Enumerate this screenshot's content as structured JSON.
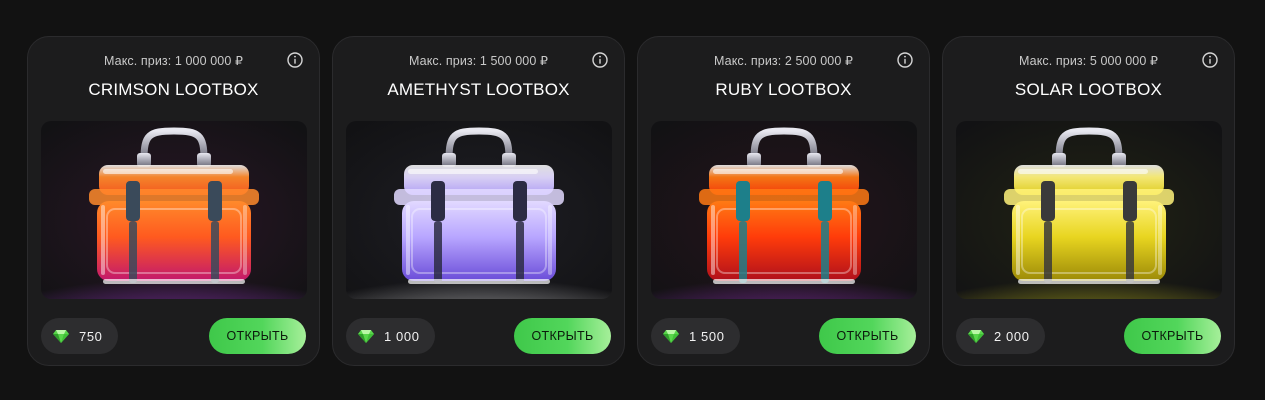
{
  "lootboxes": [
    {
      "prize": "Макс. приз: 1 000 000 ₽",
      "title": "CRIMSON LOOTBOX",
      "price": "750",
      "button": "ОТКРЫТЬ",
      "image": "crimson-lootbox-image",
      "colors": {
        "top": "#ff8a2b",
        "glowA": "#ff5a1f",
        "glowB": "#c2186d",
        "floor": "#a33ad6",
        "clasp": "#3a4a5a",
        "back": "#2a1626"
      }
    },
    {
      "prize": "Макс. приз: 1 500 000 ₽",
      "title": "AMETHYST LOOTBOX",
      "price": "1 000",
      "button": "ОТКРЫТЬ",
      "image": "amethyst-lootbox-image",
      "colors": {
        "top": "#e2d9ff",
        "glowA": "#b8a6ff",
        "glowB": "#6a4cd8",
        "floor": "#d8d8d8",
        "clasp": "#2c2c44",
        "back": "#1f1f25"
      }
    },
    {
      "prize": "Макс. приз: 2 500 000 ₽",
      "title": "RUBY LOOTBOX",
      "price": "1 500",
      "button": "ОТКРЫТЬ",
      "image": "ruby-lootbox-image",
      "colors": {
        "top": "#ff7a14",
        "glowA": "#ff3c0a",
        "glowB": "#b0101c",
        "floor": "#9c34cc",
        "clasp": "#1d7f8a",
        "back": "#26141c"
      }
    },
    {
      "prize": "Макс. приз: 5 000 000 ₽",
      "title": "SOLAR LOOTBOX",
      "price": "2 000",
      "button": "ОТКРЫТЬ",
      "image": "solar-lootbox-image",
      "colors": {
        "top": "#fff27a",
        "glowA": "#e8d520",
        "glowB": "#9c8a08",
        "floor": "#c8c21e",
        "clasp": "#3a3a3a",
        "back": "#222414"
      }
    }
  ],
  "icons": {
    "info": "info-icon",
    "gem": "gem-icon"
  },
  "accent": "#4fd158"
}
